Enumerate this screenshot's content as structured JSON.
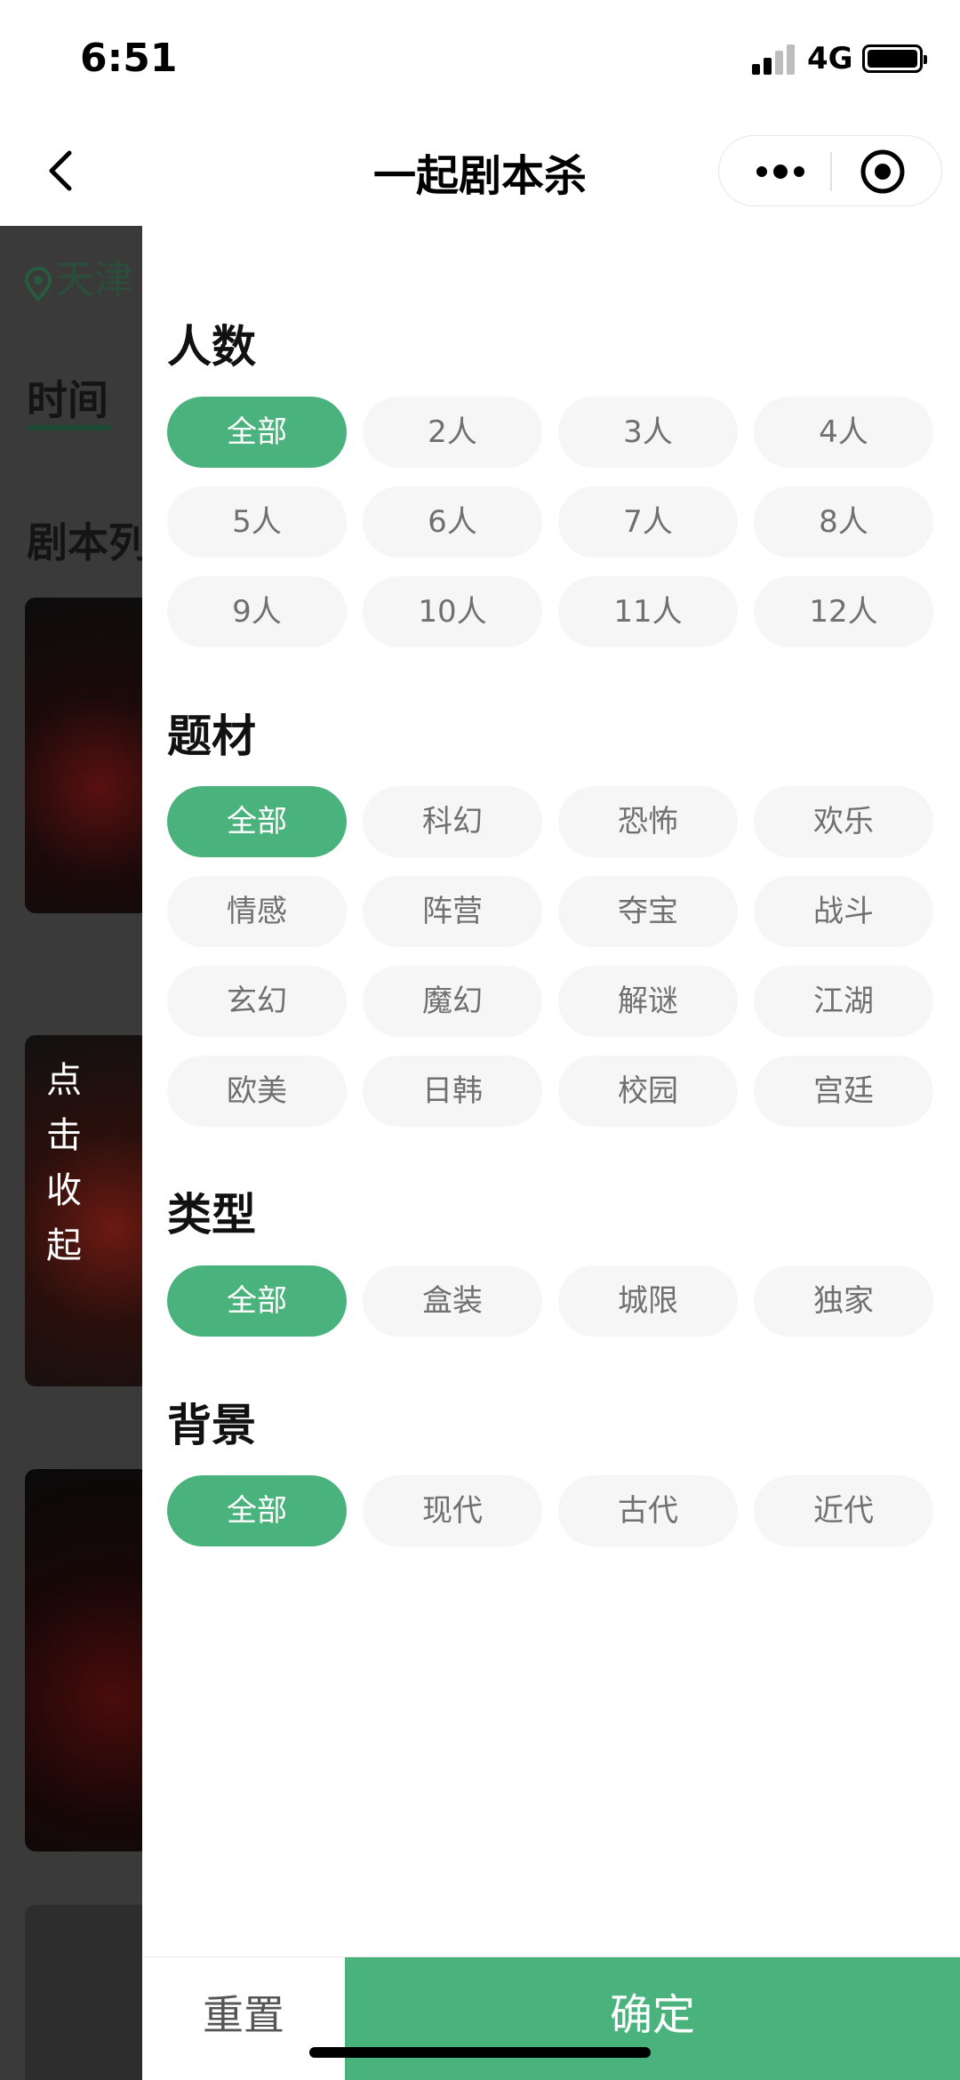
{
  "status_bar": {
    "time": "6:51",
    "network": "4G"
  },
  "nav": {
    "title": "一起剧本杀"
  },
  "background_page": {
    "location": "天津",
    "tab": "时间",
    "section": "剧本列",
    "collapse_hint": [
      "点",
      "击",
      "收",
      "起"
    ]
  },
  "filters": {
    "people": {
      "title": "人数",
      "options": [
        "全部",
        "2人",
        "3人",
        "4人",
        "5人",
        "6人",
        "7人",
        "8人",
        "9人",
        "10人",
        "11人",
        "12人"
      ],
      "selected": "全部"
    },
    "theme": {
      "title": "题材",
      "options": [
        "全部",
        "科幻",
        "恐怖",
        "欢乐",
        "情感",
        "阵营",
        "夺宝",
        "战斗",
        "玄幻",
        "魔幻",
        "解谜",
        "江湖",
        "欧美",
        "日韩",
        "校园",
        "宫廷"
      ],
      "selected": "全部"
    },
    "type": {
      "title": "类型",
      "options": [
        "全部",
        "盒装",
        "城限",
        "独家"
      ],
      "selected": "全部"
    },
    "background": {
      "title": "背景",
      "options": [
        "全部",
        "现代",
        "古代",
        "近代"
      ],
      "selected": "全部"
    }
  },
  "actions": {
    "reset": "重置",
    "confirm": "确定"
  },
  "colors": {
    "accent": "#4ab27d",
    "chip_bg": "#f6f6f6",
    "chip_text": "#707070"
  },
  "icons": {
    "back": "chevron-left-icon",
    "more": "more-dots-icon",
    "close": "target-circle-icon",
    "location": "location-pin-icon"
  }
}
